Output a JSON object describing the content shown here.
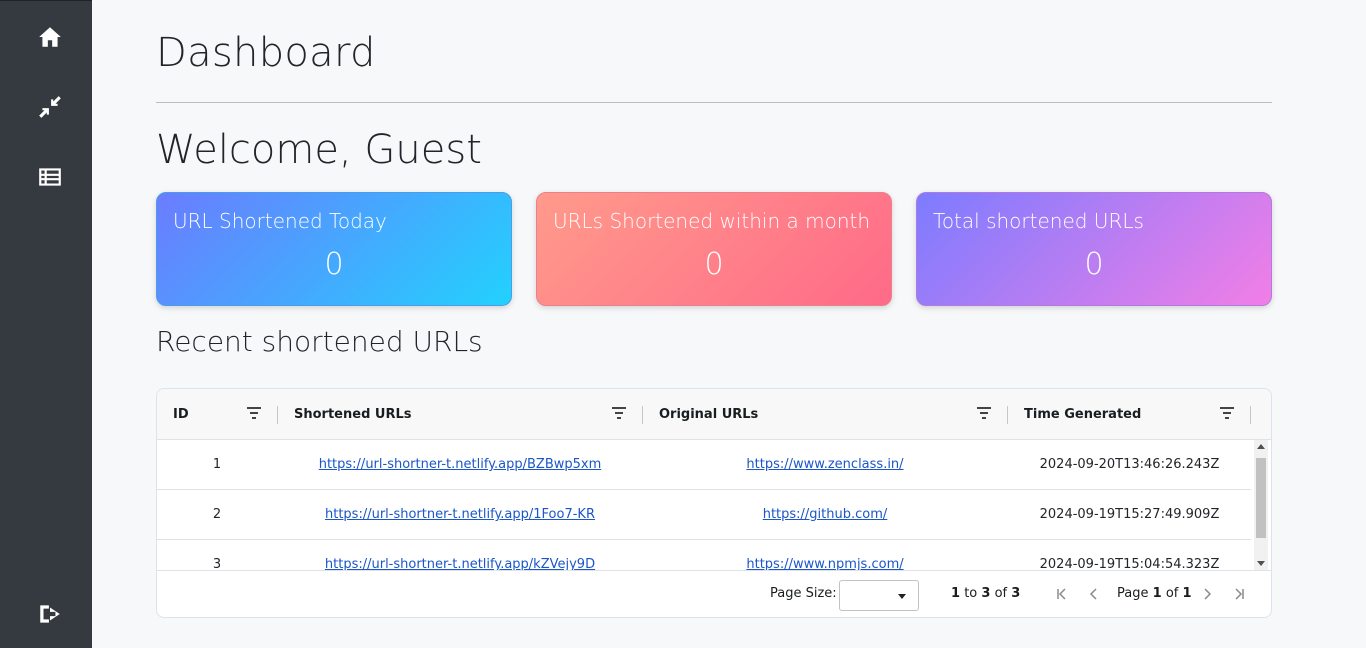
{
  "sidebar": {
    "icons": [
      "home-icon",
      "compress-icon",
      "list-icon",
      "logout-icon"
    ]
  },
  "page": {
    "title": "Dashboard",
    "welcome": "Welcome, Guest"
  },
  "cards": [
    {
      "title": "URL Shortened Today",
      "value": "0"
    },
    {
      "title": "URLs Shortened within a month",
      "value": "0"
    },
    {
      "title": "Total shortened URLs",
      "value": "0"
    }
  ],
  "recent": {
    "title": "Recent shortened URLs",
    "columns": [
      "ID",
      "Shortened URLs",
      "Original URLs",
      "Time Generated"
    ],
    "rows": [
      {
        "id": "1",
        "short": "https://url-shortner-t.netlify.app/BZBwp5xm",
        "original": "https://www.zenclass.in/",
        "time": "2024-09-20T13:46:26.243Z"
      },
      {
        "id": "2",
        "short": "https://url-shortner-t.netlify.app/1Foo7-KR",
        "original": "https://github.com/",
        "time": "2024-09-19T15:27:49.909Z"
      },
      {
        "id": "3",
        "short": "https://url-shortner-t.netlify.app/kZVejy9D",
        "original": "https://www.npmjs.com/",
        "time": "2024-09-19T15:04:54.323Z"
      }
    ]
  },
  "paging": {
    "page_size_label": "Page Size:",
    "page_size_value": "",
    "range_from": "1",
    "range_to": "3",
    "range_total": "3",
    "to_word": "to",
    "of_word": "of",
    "page_word": "Page",
    "page_current": "1",
    "page_total": "1"
  }
}
